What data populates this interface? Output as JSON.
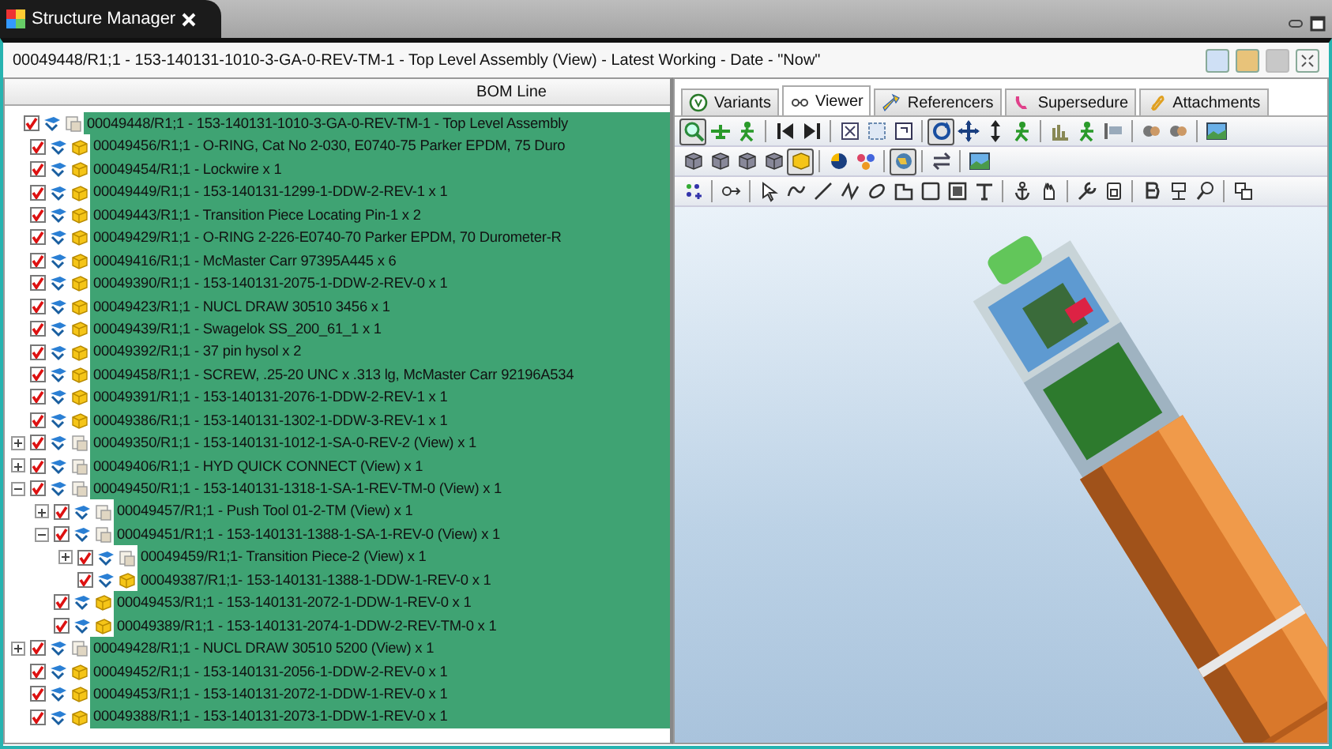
{
  "tab": {
    "title": "Structure Manager"
  },
  "header": {
    "title": "00049448/R1;1 - 153-140131-1010-3-GA-0-REV-TM-1 - Top Level Assembly (View) - Latest Working - Date - \"Now\""
  },
  "bom": {
    "column": "BOM Line",
    "tree": [
      {
        "label": "00049448/R1;1 - 153-140131-1010-3-GA-0-REV-TM-1 - Top Level Assembly",
        "kind": "assembly",
        "checked": true,
        "selected": true,
        "children": [
          {
            "label": "00049456/R1;1 - O-RING, Cat No 2-030, E0740-75 Parker EPDM, 75 Duro",
            "kind": "part",
            "checked": true,
            "selected": true
          },
          {
            "label": "00049454/R1;1 - Lockwire x 1",
            "kind": "part",
            "checked": true,
            "selected": true
          },
          {
            "label": "00049449/R1;1 - 153-140131-1299-1-DDW-2-REV-1 x 1",
            "kind": "part",
            "checked": true,
            "selected": true
          },
          {
            "label": "00049443/R1;1 - Transition Piece Locating Pin-1 x 2",
            "kind": "part",
            "checked": true,
            "selected": true
          },
          {
            "label": "00049429/R1;1 - O-RING 2-226-E0740-70 Parker EPDM, 70 Durometer-R",
            "kind": "part",
            "checked": true,
            "selected": true
          },
          {
            "label": "00049416/R1;1 - McMaster Carr 97395A445 x 6",
            "kind": "part",
            "checked": true,
            "selected": true
          },
          {
            "label": "00049390/R1;1 - 153-140131-2075-1-DDW-2-REV-0 x 1",
            "kind": "part",
            "checked": true,
            "selected": true
          },
          {
            "label": "00049423/R1;1 - NUCL DRAW 30510 3456 x 1",
            "kind": "part",
            "checked": true,
            "selected": true
          },
          {
            "label": "00049439/R1;1 - Swagelok SS_200_61_1 x 1",
            "kind": "part",
            "checked": true,
            "selected": true
          },
          {
            "label": "00049392/R1;1 - 37 pin hysol x 2",
            "kind": "part",
            "checked": true,
            "selected": true
          },
          {
            "label": "00049458/R1;1 - SCREW, .25-20 UNC x .313 lg, McMaster Carr 92196A534",
            "kind": "part",
            "checked": true,
            "selected": true
          },
          {
            "label": "00049391/R1;1 - 153-140131-2076-1-DDW-2-REV-1 x 1",
            "kind": "part",
            "checked": true,
            "selected": true
          },
          {
            "label": "00049386/R1;1 - 153-140131-1302-1-DDW-3-REV-1 x 1",
            "kind": "part",
            "checked": true,
            "selected": true
          },
          {
            "label": "00049350/R1;1 - 153-140131-1012-1-SA-0-REV-2 (View) x 1",
            "kind": "assembly",
            "checked": true,
            "selected": true,
            "expanded": false
          },
          {
            "label": "00049406/R1;1 - HYD QUICK CONNECT (View) x 1",
            "kind": "assembly",
            "checked": true,
            "selected": true,
            "expanded": false
          },
          {
            "label": "00049450/R1;1 - 153-140131-1318-1-SA-1-REV-TM-0 (View) x 1",
            "kind": "assembly",
            "checked": true,
            "selected": true,
            "expanded": true,
            "children": [
              {
                "label": "00049457/R1;1 - Push Tool 01-2-TM (View) x 1",
                "kind": "assembly",
                "checked": true,
                "selected": true,
                "expanded": false
              },
              {
                "label": "00049451/R1;1 - 153-140131-1388-1-SA-1-REV-0 (View) x 1",
                "kind": "assembly",
                "checked": true,
                "selected": true,
                "expanded": true,
                "children": [
                  {
                    "label": "00049459/R1;1- Transition Piece-2 (View) x 1",
                    "kind": "assembly",
                    "checked": true,
                    "selected": true,
                    "expanded": false
                  },
                  {
                    "label": "00049387/R1;1- 153-140131-1388-1-DDW-1-REV-0 x 1",
                    "kind": "part",
                    "checked": true,
                    "selected": true
                  }
                ]
              },
              {
                "label": "00049453/R1;1 - 153-140131-2072-1-DDW-1-REV-0 x 1",
                "kind": "part",
                "checked": true,
                "selected": true
              },
              {
                "label": "00049389/R1;1 - 153-140131-2074-1-DDW-2-REV-TM-0 x 1",
                "kind": "part",
                "checked": true,
                "selected": true
              }
            ]
          },
          {
            "label": "00049428/R1;1 - NUCL DRAW 30510 5200 (View) x 1",
            "kind": "assembly",
            "checked": true,
            "selected": true,
            "expanded": false
          },
          {
            "label": "00049452/R1;1 - 153-140131-2056-1-DDW-2-REV-0 x 1",
            "kind": "part",
            "checked": true,
            "selected": true
          },
          {
            "label": "00049453/R1;1 - 153-140131-2072-1-DDW-1-REV-0 x 1",
            "kind": "part",
            "checked": true,
            "selected": true
          },
          {
            "label": "00049388/R1;1 - 153-140131-2073-1-DDW-1-REV-0 x 1",
            "kind": "part",
            "checked": true,
            "selected": true
          }
        ]
      }
    ]
  },
  "viewer_tabs": [
    {
      "label": "Variants",
      "selected": false
    },
    {
      "label": "Viewer",
      "selected": true
    },
    {
      "label": "Referencers",
      "selected": false
    },
    {
      "label": "Supersedure",
      "selected": false
    },
    {
      "label": "Attachments",
      "selected": false
    }
  ],
  "toolbars": [
    [
      {
        "selected": true
      },
      {
        "selected": false
      },
      {
        "selected": false
      },
      {
        "selected": false
      },
      {
        "selected": false
      },
      {
        "selected": false
      },
      {
        "selected": false
      },
      {
        "selected": false
      },
      {
        "selected": true
      },
      {
        "selected": false
      },
      {
        "selected": false
      },
      {
        "selected": false
      },
      {
        "selected": false
      },
      {
        "selected": false
      },
      {
        "selected": false
      },
      {
        "selected": false
      },
      {
        "selected": false
      },
      {
        "selected": false
      }
    ],
    [
      {
        "selected": false
      },
      {
        "selected": false
      },
      {
        "selected": false
      },
      {
        "selected": false
      },
      {
        "selected": true
      },
      {
        "selected": false
      },
      {
        "selected": false
      },
      {
        "selected": true
      },
      {
        "selected": false
      },
      {
        "selected": false
      }
    ],
    [
      {
        "selected": false
      },
      {
        "selected": false
      },
      {
        "selected": false
      },
      {
        "selected": false
      },
      {
        "selected": false
      },
      {
        "selected": false
      },
      {
        "selected": false
      },
      {
        "selected": false
      },
      {
        "selected": false
      },
      {
        "selected": false
      },
      {
        "selected": false
      },
      {
        "selected": false
      },
      {
        "selected": false
      },
      {
        "selected": false
      },
      {
        "selected": false
      },
      {
        "selected": false
      },
      {
        "selected": false
      },
      {
        "selected": false
      },
      {
        "selected": false
      }
    ]
  ]
}
